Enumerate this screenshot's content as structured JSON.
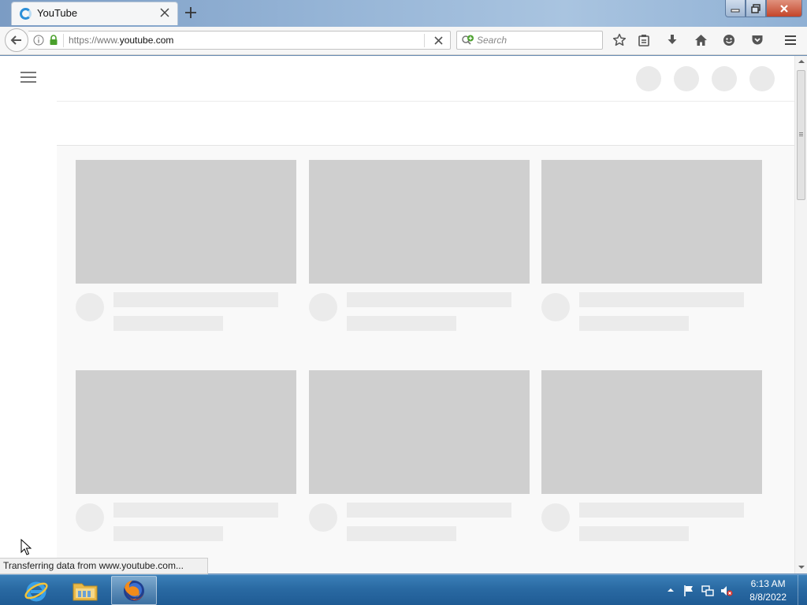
{
  "browser": {
    "tab": {
      "title": "YouTube"
    },
    "url": {
      "prefix": "https://www.",
      "host": "youtube.com"
    },
    "search": {
      "placeholder": "Search"
    },
    "status_text": "Transferring data from www.youtube.com..."
  },
  "taskbar": {
    "apps": [
      {
        "name": "Internet Explorer",
        "icon": "ie-icon"
      },
      {
        "name": "Windows Explorer",
        "icon": "folder-icon"
      },
      {
        "name": "Firefox",
        "icon": "firefox-icon",
        "active": true
      }
    ],
    "clock": {
      "time": "6:13 AM",
      "date": "8/8/2022"
    }
  },
  "page": {
    "loading_skeleton": true,
    "skeleton_cards": 6
  },
  "colors": {
    "skeleton_thumb": "#cfcfcf",
    "skeleton_line": "#ebebeb",
    "feed_bg": "#f9f9f9",
    "taskbar": "#2a6aa3"
  }
}
